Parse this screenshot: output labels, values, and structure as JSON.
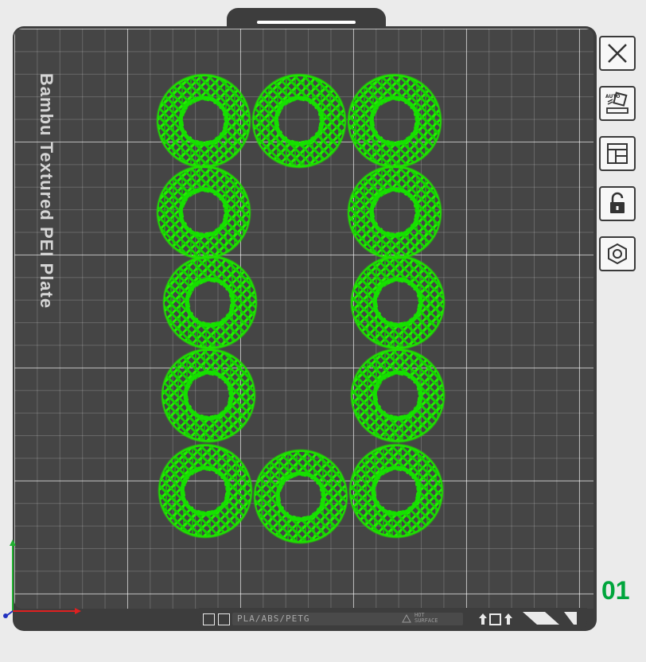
{
  "plate": {
    "name": "Bambu Textured PEI Plate",
    "number": "01",
    "model_count": 12
  },
  "toolbar": {
    "items": [
      {
        "icon": "close-icon",
        "label": ""
      },
      {
        "icon": "auto-bed-level-icon",
        "label": "AUTO"
      },
      {
        "icon": "layout-icon",
        "label": ""
      },
      {
        "icon": "lock-icon",
        "label": ""
      },
      {
        "icon": "hex-nut-icon",
        "label": ""
      }
    ]
  },
  "bottom_bar": {
    "material": "PLA/ABS/PETG",
    "hot_line1": "HOT",
    "hot_line2": "SURFACE"
  },
  "colors": {
    "model": "#1fe000",
    "plate": "#3d3d3d",
    "grid_bg": "#454545",
    "plate_number": "#00a53c",
    "axis_x": "#e02020",
    "axis_y": "#20b030",
    "axis_z": "#2030c0"
  }
}
